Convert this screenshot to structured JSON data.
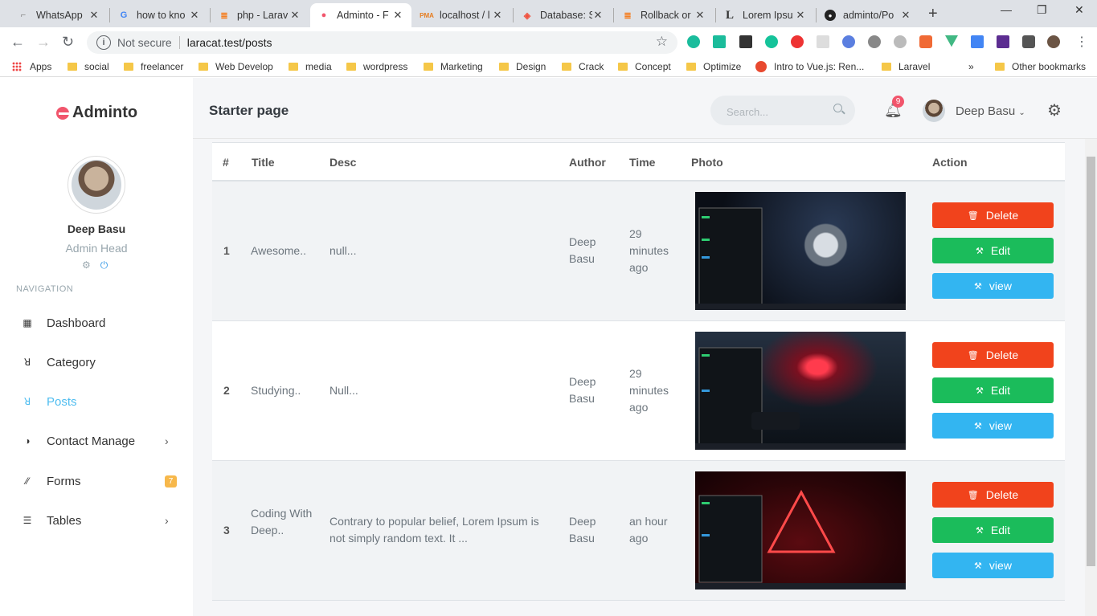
{
  "browser": {
    "tabs": [
      {
        "title": "WhatsApp",
        "icon": "whatsapp-icon",
        "active": false
      },
      {
        "title": "how to kno",
        "icon": "google-icon",
        "active": false
      },
      {
        "title": "php - Larav",
        "icon": "stackoverflow-icon",
        "active": false
      },
      {
        "title": "Adminto - F",
        "icon": "adminto-icon",
        "active": true
      },
      {
        "title": "localhost / l",
        "icon": "phpmyadmin-icon",
        "active": false
      },
      {
        "title": "Database: S",
        "icon": "laravel-icon",
        "active": false
      },
      {
        "title": "Rollback or",
        "icon": "stackoverflow-icon",
        "active": false
      },
      {
        "title": "Lorem Ipsu",
        "icon": "lorem-icon",
        "active": false
      },
      {
        "title": "adminto/Po",
        "icon": "github-icon",
        "active": false
      }
    ],
    "address": {
      "security": "Not secure",
      "url": "laracat.test/posts"
    },
    "bookmarks": [
      "Apps",
      "social",
      "freelancer",
      "Web Develop",
      "media",
      "wordpress",
      "Marketing",
      "Design",
      "Crack",
      "Concept",
      "Optimize",
      "Intro to Vue.js: Ren...",
      "Laravel",
      "»",
      "Other bookmarks"
    ]
  },
  "sidebar": {
    "brand": "Adminto",
    "user": {
      "name": "Deep Basu",
      "role": "Admin Head"
    },
    "nav_header": "NAVIGATION",
    "items": [
      {
        "label": "Dashboard",
        "icon": "dashboard-icon"
      },
      {
        "label": "Category",
        "icon": "category-icon"
      },
      {
        "label": "Posts",
        "icon": "posts-icon",
        "active": true
      },
      {
        "label": "Contact Manage",
        "icon": "contact-icon",
        "chevron": true
      },
      {
        "label": "Forms",
        "icon": "forms-icon",
        "badge": "7"
      },
      {
        "label": "Tables",
        "icon": "tables-icon",
        "chevron": true
      }
    ]
  },
  "topbar": {
    "page_title": "Starter page",
    "search_placeholder": "Search...",
    "notifications_count": "9",
    "user_name": "Deep Basu"
  },
  "table": {
    "headers": [
      "#",
      "Title",
      "Desc",
      "Author",
      "Time",
      "Photo",
      "Action"
    ],
    "rows": [
      {
        "num": "1",
        "title": "Awesome..",
        "desc": "null...",
        "author": "Deep Basu",
        "time": "29 minutes ago",
        "photo": "astronaut-wallpaper"
      },
      {
        "num": "2",
        "title": "Studying..",
        "desc": "Null...",
        "author": "Deep Basu",
        "time": "29 minutes ago",
        "photo": "red-light-forest-wallpaper"
      },
      {
        "num": "3",
        "title": "Coding With Deep..",
        "desc": "Contrary to popular belief, Lorem Ipsum is not simply random text. It ...",
        "author": "Deep Basu",
        "time": "an hour ago",
        "photo": "neon-triangle-wallpaper"
      }
    ],
    "actions": {
      "delete": "Delete",
      "edit": "Edit",
      "view": "view"
    }
  },
  "colors": {
    "accent": "#4fbdf0",
    "delete": "#f1431c",
    "edit": "#1bbc5b",
    "view": "#33b5f1",
    "brand": "#f1556c"
  }
}
